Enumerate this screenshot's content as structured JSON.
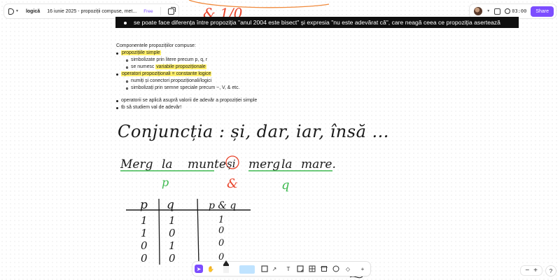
{
  "header": {
    "brand": "logică",
    "page_title": "16 iunie 2025 - propoziții compuse, met...",
    "plan": "Free",
    "timer": "03:00",
    "share_label": "Share"
  },
  "banner": {
    "text": "se poate face diferența între propoziția \"anul 2004 este bisect\" și expresia \"nu este adevărat că\", care neagă ceea ce propoziția asertează"
  },
  "notes": {
    "heading": "Componentele propozițiilor compuse:",
    "items": [
      {
        "label": "propozițiile simple",
        "sub": [
          {
            "text": "simbolizate prin litere precum p, q, r"
          },
          {
            "prefix": "se numesc ",
            "highlight": "variabile propoziționale"
          }
        ]
      },
      {
        "label": "operatori propoziționali = constante logice",
        "sub": [
          {
            "text": "numiți și conectori propoziționali/logici"
          },
          {
            "text": "simbolizați prin semne speciale precum ~, V, & etc."
          }
        ]
      }
    ],
    "extra": [
      "operatorii se aplică asupră valorii de adevăr a propoziției simple",
      "tb să studiem val de adevăr!"
    ]
  },
  "handwriting": {
    "top_symbols": "& 1/0",
    "conjunctia": "Conjuncția : și, dar, iar, însă ...",
    "w_merg1": "Merg",
    "w_la1": "la",
    "w_munte": "munte",
    "w_si": "și",
    "w_merg2": "merg",
    "w_la2": "la",
    "w_mare": "mare.",
    "p_label": "p",
    "and_label": "&",
    "q_label": "q",
    "table_header": [
      "p",
      "q",
      "p & q"
    ],
    "table_rows": [
      [
        "1",
        "1",
        "1"
      ],
      [
        "1",
        "0",
        "0"
      ],
      [
        "0",
        "1",
        "0"
      ],
      [
        "0",
        "0",
        "0"
      ]
    ]
  },
  "colors": {
    "accent": "#7c4dff",
    "highlight": "#fff06a",
    "ink_black": "#1a1a1a",
    "ink_green": "#3fb950",
    "ink_red": "#e8452c",
    "ink_orange": "#f08a3c"
  },
  "toolbar": {
    "tools": [
      "pointer-icon",
      "hand-icon",
      "pen-icon",
      "highlighter-icon",
      "eraser-icon",
      "shapes-icon",
      "arrow-icon",
      "text-icon",
      "sticky-note-icon",
      "table-icon",
      "frame-icon",
      "comment-icon",
      "plugin-icon",
      "more-icon"
    ]
  },
  "zoom": {
    "minus": "−",
    "plus": "+"
  },
  "help_label": "?"
}
